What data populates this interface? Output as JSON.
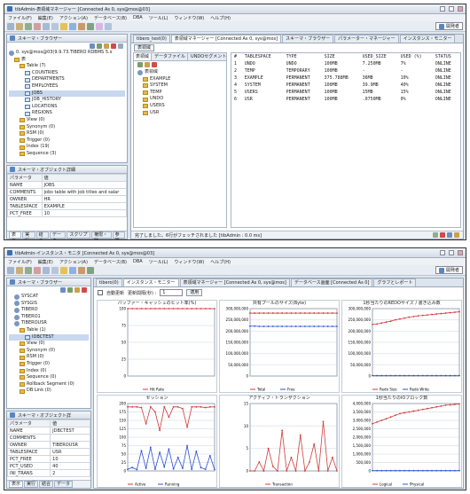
{
  "w1": {
    "title": "tibAdmin-表領域マネージャー [Connected As 0, sys@mos@03]",
    "menu": [
      "ファイル(F)",
      "編集(E)",
      "アクション(A)",
      "データベース(B)",
      "DBA",
      "ツール(L)",
      "ウィンドウ(W)",
      "ヘルプ(H)"
    ],
    "persp": "開発者",
    "browser_title": "スキーマ・ブラウザー",
    "tree": [
      {
        "label": "0. sys@mos@03(9.9.73.TIBERO RDBMS 5.x",
        "indent": 0,
        "icon": "db"
      },
      {
        "label": "表",
        "indent": 1,
        "icon": "folder"
      },
      {
        "label": "Table (7)",
        "indent": 2,
        "icon": "folder"
      },
      {
        "label": "COUNTRIES",
        "indent": 3,
        "icon": "tbl"
      },
      {
        "label": "DEPARTMENTS",
        "indent": 3,
        "icon": "tbl"
      },
      {
        "label": "EMPLOYEES",
        "indent": 3,
        "icon": "tbl"
      },
      {
        "label": "JOBS",
        "indent": 3,
        "icon": "tbl",
        "sel": true
      },
      {
        "label": "JOB_HISTORY",
        "indent": 3,
        "icon": "tbl"
      },
      {
        "label": "LOCATIONS",
        "indent": 3,
        "icon": "tbl"
      },
      {
        "label": "REGIONS",
        "indent": 3,
        "icon": "tbl"
      },
      {
        "label": "View (0)",
        "indent": 2,
        "icon": "folder"
      },
      {
        "label": "Synonym (0)",
        "indent": 2,
        "icon": "folder"
      },
      {
        "label": "RSM (0)",
        "indent": 2,
        "icon": "folder"
      },
      {
        "label": "Trigger (0)",
        "indent": 2,
        "icon": "folder"
      },
      {
        "label": "Index (19)",
        "indent": 2,
        "icon": "folder"
      },
      {
        "label": "Sequence (3)",
        "indent": 2,
        "icon": "folder"
      }
    ],
    "obj_title": "スキーマ・オブジェクト詳細",
    "props_head": [
      "パラメータ",
      "値"
    ],
    "props": [
      [
        "NAME",
        "JOBS"
      ],
      [
        "COMMENTS",
        "jobs table with job titles and salar"
      ],
      [
        "OWNER",
        "HR"
      ],
      [
        "TABLESPACE",
        "EXAMPLE"
      ],
      [
        "PCT_FREE",
        "10"
      ]
    ],
    "bottom_tabs": [
      "表示",
      "実行",
      "結合",
      "データ",
      "スクリプト",
      "権限・監",
      "参照"
    ],
    "tabs": [
      "tibero_test(0)",
      "表領域マネージャー [Connected As 0, sys@mos]",
      "スキーマ・ブラウザー",
      "パラメーター・マネージャー",
      "インスタンス・モニター"
    ],
    "ts_head": "表領域",
    "ts_subtabs": [
      "表領域",
      "データファイル",
      "UNDOセグメント"
    ],
    "ts_tree": [
      "表領域",
      "EXAMPLE",
      "SYSTEM",
      "TEMP",
      "UNDO",
      "USERS",
      "USR"
    ],
    "cols": [
      "#",
      "TABLESPACE",
      "TYPE",
      "SIZE",
      "USED_SIZE",
      "USED (%)",
      "STATUS"
    ],
    "rows": [
      [
        "1",
        "UNDO",
        "UNDO",
        "100MB",
        "7.250MB",
        "7%",
        "ONLINE"
      ],
      [
        "2",
        "TEMP",
        "TEMPORARY",
        "100MB",
        "-",
        "-",
        "ONLINE"
      ],
      [
        "3",
        "EXAMPLE",
        "PERMANENT",
        "375.788MB",
        "36MB",
        "10%",
        "ONLINE"
      ],
      [
        "4",
        "SYSTEM",
        "PERMANENT",
        "100MB",
        "39.9MB",
        "40%",
        "ONLINE"
      ],
      [
        "5",
        "USERS",
        "PERMANENT",
        "100MB",
        "15MB",
        "15%",
        "ONLINE"
      ],
      [
        "6",
        "USR",
        "PERMANENT",
        "100MB",
        ".0750MB",
        "0%",
        "ONLINE"
      ]
    ],
    "status": "完了しました。6行がフェッチされました [tibAdmin : 0.0 ms]"
  },
  "w2": {
    "title": "tibAdmin-インスタンス・モニタ [Connected As 0, sys@mos@03]",
    "menu": [
      "ファイル(F)",
      "編集(E)",
      "アクション(A)",
      "データベース(B)",
      "DBA",
      "ツール(L)",
      "ウィンドウ(W)",
      "ヘルプ(H)"
    ],
    "persp": "開発者",
    "browser_title": "スキーマ・ブラウザー",
    "tree": [
      {
        "label": "SYSCAT",
        "indent": 1,
        "icon": "db"
      },
      {
        "label": "SYSGIS",
        "indent": 1,
        "icon": "db"
      },
      {
        "label": "TIBERO",
        "indent": 1,
        "icon": "db"
      },
      {
        "label": "TIBERO1",
        "indent": 1,
        "icon": "db"
      },
      {
        "label": "TIBEROUSR",
        "indent": 1,
        "icon": "db"
      },
      {
        "label": "Table (1)",
        "indent": 2,
        "icon": "folder"
      },
      {
        "label": "IDBCTEST",
        "indent": 3,
        "icon": "tbl",
        "sel": true
      },
      {
        "label": "View (0)",
        "indent": 2,
        "icon": "folder"
      },
      {
        "label": "Synonym (0)",
        "indent": 2,
        "icon": "folder"
      },
      {
        "label": "RSM (0)",
        "indent": 2,
        "icon": "folder"
      },
      {
        "label": "Trigger (0)",
        "indent": 2,
        "icon": "folder"
      },
      {
        "label": "Index (0)",
        "indent": 2,
        "icon": "folder"
      },
      {
        "label": "Sequence (0)",
        "indent": 2,
        "icon": "folder"
      },
      {
        "label": "Rollback Segment (0)",
        "indent": 2,
        "icon": "folder"
      },
      {
        "label": "DB Link (0)",
        "indent": 2,
        "icon": "folder"
      }
    ],
    "obj_title": "スキーマ・オブジェクト詳",
    "props_head": [
      "パラメータ",
      "値"
    ],
    "props": [
      [
        "NAME",
        "JDBCTEST"
      ],
      [
        "COMMENTS",
        ""
      ],
      [
        "OWNER",
        "TIBEROUSR"
      ],
      [
        "TABLESPACE",
        "USR"
      ],
      [
        "PCT_FREE",
        "10"
      ],
      [
        "PCT_USED",
        "40"
      ],
      [
        "INI_TRANS",
        "2"
      ]
    ],
    "bottom_tabs": [
      "表示",
      "実行",
      "結合",
      "データ"
    ],
    "tabs": [
      "tibero(0)",
      "インスタンス・モニター",
      "表領域マネージャー [Connected As 0, sys@mos]",
      "データベース画面 [Connected As 0]",
      "グラフとレポート"
    ],
    "refresh_label": "自動更新",
    "interval_label": "更新間隔(秒) :",
    "interval_value": "1",
    "apply": "適用",
    "charts": [
      {
        "title": "バッファー・キャッシュのヒット率(%)",
        "ymax": 100,
        "ticks": [
          "0",
          "25",
          "50",
          "75",
          "100"
        ],
        "legend": [
          "Hit Rate"
        ]
      },
      {
        "title": "共有プールのサイズ(Byte)",
        "ymax": 300000000,
        "ticks": [
          "0",
          "50,000,000",
          "100,000,000",
          "150,000,000",
          "200,000,000",
          "250,000,000",
          "300,000,000"
        ],
        "legend": [
          "Total",
          "Free"
        ]
      },
      {
        "title": "1秒当たりのREDOサイズ / 書き込み数",
        "ymax": 300000000,
        "ticks": [
          "0",
          "50,000,000",
          "100,000,000",
          "150,000,000",
          "200,000,000",
          "250,000,000",
          "300,000,000"
        ],
        "legend": [
          "Redo Size",
          "Redo Write"
        ]
      },
      {
        "title": "セッション",
        "ymax": 200,
        "ticks": [
          "0",
          "25",
          "50",
          "75",
          "100",
          "125",
          "150",
          "175",
          "200"
        ],
        "legend": [
          "Active",
          "Running"
        ]
      },
      {
        "title": "アクティブ・トランザクション",
        "ymax": 15,
        "ticks": [
          "0",
          "5",
          "10",
          "15"
        ],
        "legend": [
          "Transaction"
        ]
      },
      {
        "title": "1秒当たりのIOブロック数",
        "ymax": 4000000,
        "ticks": [
          "0",
          "500,000",
          "1,000,000",
          "1,500,000",
          "2,000,000",
          "2,500,000",
          "3,000,000",
          "3,500,000",
          "4,000,000"
        ],
        "legend": [
          "Logical",
          "Physical"
        ]
      }
    ],
    "chart_data": [
      {
        "type": "line",
        "title": "バッファー・キャッシュのヒット率(%)",
        "series": [
          {
            "name": "Hit Rate",
            "values": [
              100,
              100,
              100,
              100,
              100,
              100,
              100,
              100,
              100,
              100,
              100,
              100,
              100,
              100,
              100,
              100,
              100,
              100,
              100,
              100
            ]
          }
        ],
        "ylim": [
          0,
          100
        ]
      },
      {
        "type": "line",
        "title": "共有プールのサイズ(Byte)",
        "series": [
          {
            "name": "Total",
            "values": [
              280000000,
              280000000,
              280000000,
              280000000,
              280000000,
              280000000,
              280000000,
              280000000,
              280000000,
              280000000,
              280000000,
              280000000,
              280000000,
              280000000,
              280000000,
              280000000,
              280000000,
              280000000,
              280000000,
              280000000
            ]
          },
          {
            "name": "Free",
            "values": [
              222000000,
              222000000,
              221000000,
              221000000,
              221000000,
              221000000,
              221000000,
              221000000,
              221000000,
              221000000,
              221000000,
              221000000,
              221000000,
              221000000,
              221000000,
              221000000,
              221000000,
              221000000,
              221000000,
              221000000
            ]
          }
        ],
        "ylim": [
          0,
          300000000
        ]
      },
      {
        "type": "line",
        "title": "1秒当たりのREDOサイズ / 書き込み数",
        "series": [
          {
            "name": "Redo Size",
            "values": [
              230000000,
              232000000,
              236000000,
              240000000,
              244000000,
              250000000,
              254000000,
              258000000,
              262000000,
              265000000,
              268000000,
              270000000,
              272000000,
              274000000,
              276000000,
              278000000,
              280000000,
              282000000,
              284000000,
              286000000
            ]
          },
          {
            "name": "Redo Write",
            "values": [
              2000000,
              2000000,
              2000000,
              2000000,
              2000000,
              2000000,
              2000000,
              2000000,
              2000000,
              2000000,
              2000000,
              2000000,
              2000000,
              2000000,
              2000000,
              2000000,
              2000000,
              2000000,
              2000000,
              2000000
            ]
          }
        ],
        "ylim": [
          0,
          300000000
        ]
      },
      {
        "type": "line",
        "title": "セッション",
        "series": [
          {
            "name": "Active",
            "values": [
              190,
              190,
              190,
              188,
              140,
              190,
              175,
              120,
              190,
              160,
              190,
              190,
              185,
              130,
              190,
              190,
              190,
              188,
              190,
              190
            ]
          },
          {
            "name": "Running",
            "values": [
              5,
              10,
              4,
              60,
              8,
              70,
              5,
              55,
              12,
              65,
              6,
              40,
              8,
              75,
              5,
              58,
              10,
              5,
              45,
              4
            ]
          }
        ],
        "ylim": [
          0,
          200
        ]
      },
      {
        "type": "line",
        "title": "アクティブ・トランザクション",
        "series": [
          {
            "name": "Transaction",
            "values": [
              0,
              0,
              2,
              0,
              5,
              1,
              0,
              9,
              0,
              3,
              0,
              8,
              0,
              2,
              6,
              0,
              11,
              0,
              3,
              0
            ]
          }
        ],
        "ylim": [
          0,
          15
        ]
      },
      {
        "type": "line",
        "title": "1秒当たりのIOブロック数",
        "series": [
          {
            "name": "Logical",
            "values": [
              2800000,
              2900000,
              3000000,
              3100000,
              3200000,
              3300000,
              3400000,
              3450000,
              3500000,
              3550000,
              3600000,
              3650000,
              3700000,
              3750000,
              3800000,
              3850000,
              3900000,
              3920000,
              3950000,
              3980000
            ]
          },
          {
            "name": "Physical",
            "values": [
              20000,
              20000,
              20000,
              20000,
              20000,
              20000,
              20000,
              20000,
              20000,
              20000,
              20000,
              20000,
              20000,
              20000,
              20000,
              20000,
              20000,
              20000,
              20000,
              20000
            ]
          }
        ],
        "ylim": [
          0,
          4000000
        ]
      }
    ],
    "colors": [
      "#d23b3b",
      "#2b4fd6"
    ]
  }
}
